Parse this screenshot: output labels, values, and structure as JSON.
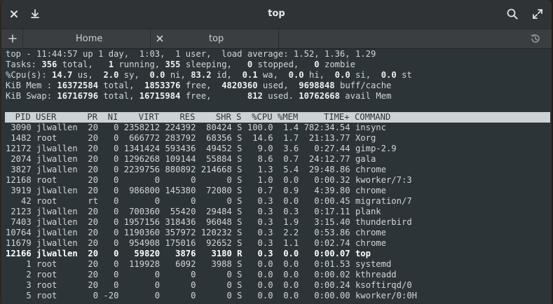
{
  "window": {
    "title": "top",
    "icons": {
      "close": "close-icon",
      "download": "download-icon",
      "search": "search-icon",
      "maximize": "maximize-icon",
      "new_tab": "plus-icon",
      "history": "history-icon"
    }
  },
  "tabs": [
    {
      "label": "Home",
      "active": false
    },
    {
      "label": "top",
      "active": true
    }
  ],
  "summary": {
    "line1": "top - 11:44:57 up 1 day,  1:03,  1 user,  load average: 1.52, 1.36, 1.29",
    "tasks": {
      "prefix": "Tasks: ",
      "total": "356",
      "t1": " total,   ",
      "running": "1",
      "t2": " running, ",
      "sleeping": "355",
      "t3": " sleeping,   ",
      "stopped": "0",
      "t4": " stopped,   ",
      "zombie": "0",
      "t5": " zombie"
    },
    "cpu": {
      "prefix": "%Cpu(s): ",
      "us": "14.7",
      "t1": " us,  ",
      "sy": "2.0",
      "t2": " sy,  ",
      "ni": "0.0",
      "t3": " ni, ",
      "id": "83.2",
      "t4": " id,  ",
      "wa": "0.1",
      "t5": " wa,  ",
      "hi": "0.0",
      "t6": " hi,  ",
      "si": "0.0",
      "t7": " si,  ",
      "st": "0.0",
      "t8": " st"
    },
    "mem": {
      "prefix": "KiB Mem : ",
      "total": "16372584",
      "t1": " total,  ",
      "free": "1853376",
      "t2": " free,  ",
      "used": "4820360",
      "t3": " used,  ",
      "buff": "9698848",
      "t4": " buff/cache"
    },
    "swap": {
      "prefix": "KiB Swap: ",
      "total": "16716796",
      "t1": " total, ",
      "free": "16715984",
      "t2": " free,       ",
      "used": "812",
      "t3": " used. ",
      "avail": "10762668",
      "t4": " avail Mem"
    }
  },
  "table": {
    "header": "  PID USER      PR  NI    VIRT    RES    SHR S  %CPU %MEM     TIME+ COMMAND     ",
    "rows": [
      {
        "text": " 3090 jlwallen  20   0 2358212 224392  80424 S 100.0  1.4 782:34.54 insync",
        "bold": false
      },
      {
        "text": " 1482 root      20   0  666772 283792  68356 S  14.6  1.7  21:13.77 Xorg",
        "bold": false
      },
      {
        "text": "12172 jlwallen  20   0 1341424 593436  49452 S   9.0  3.6   0:27.44 gimp-2.9",
        "bold": false
      },
      {
        "text": " 2074 jlwallen  20   0 1296268 109144  55884 S   8.6  0.7  24:12.77 gala",
        "bold": false
      },
      {
        "text": " 3827 jlwallen  20   0 2239756 880892 214668 S   1.3  5.4  29:48.86 chrome",
        "bold": false
      },
      {
        "text": "12168 root      20   0       0      0      0 S   1.0  0.0   0:00.32 kworker/7:3",
        "bold": false
      },
      {
        "text": " 3919 jlwallen  20   0  986800 145380  72080 S   0.7  0.9   4:39.80 chrome",
        "bold": false
      },
      {
        "text": "   42 root      rt   0       0      0      0 S   0.3  0.0   0:00.45 migration/7",
        "bold": false
      },
      {
        "text": " 2123 jlwallen  20   0  700360  55420  29484 S   0.3  0.3   0:17.11 plank",
        "bold": false
      },
      {
        "text": " 7403 jlwallen  20   0 1957156 318436  96048 S   0.3  1.9   3:15.40 thunderbird",
        "bold": false
      },
      {
        "text": "10764 jlwallen  20   0 1190360 357972 120232 S   0.3  2.2   0:53.86 chrome",
        "bold": false
      },
      {
        "text": "11679 jlwallen  20   0  954908 175016  92652 S   0.3  1.1   0:02.74 chrome",
        "bold": false
      },
      {
        "text": "12166 jlwallen  20   0   59820   3876   3180 R   0.3  0.0   0:00.07 top",
        "bold": true
      },
      {
        "text": "    1 root      20   0  119928   6092   3988 S   0.0  0.0   0:01.53 systemd",
        "bold": false
      },
      {
        "text": "    2 root      20   0       0      0      0 S   0.0  0.0   0:00.02 kthreadd",
        "bold": false
      },
      {
        "text": "    3 root      20   0       0      0      0 S   0.0  0.0   0:00.24 ksoftirqd/0",
        "bold": false
      },
      {
        "text": "    5 root       0 -20       0      0      0 S   0.0  0.0   0:00.00 kworker/0:0H",
        "bold": false
      }
    ]
  }
}
